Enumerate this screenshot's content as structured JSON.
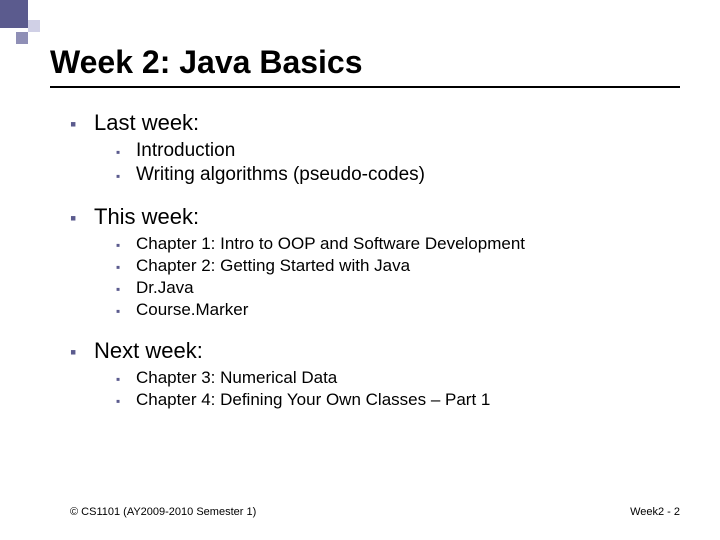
{
  "title": "Week 2: Java Basics",
  "sections": {
    "last": {
      "heading": "Last week:",
      "items": [
        "Introduction",
        "Writing algorithms (pseudo-codes)"
      ]
    },
    "this": {
      "heading": "This week:",
      "items": [
        "Chapter 1: Intro to OOP and Software Development",
        "Chapter 2: Getting Started with Java",
        "Dr.Java",
        "Course.Marker"
      ]
    },
    "next": {
      "heading": "Next week:",
      "items": [
        "Chapter 3: Numerical Data",
        "Chapter 4: Defining Your Own Classes – Part 1"
      ]
    }
  },
  "footer": {
    "left": "© CS1101 (AY2009-2010 Semester 1)",
    "right": "Week2 - 2"
  }
}
